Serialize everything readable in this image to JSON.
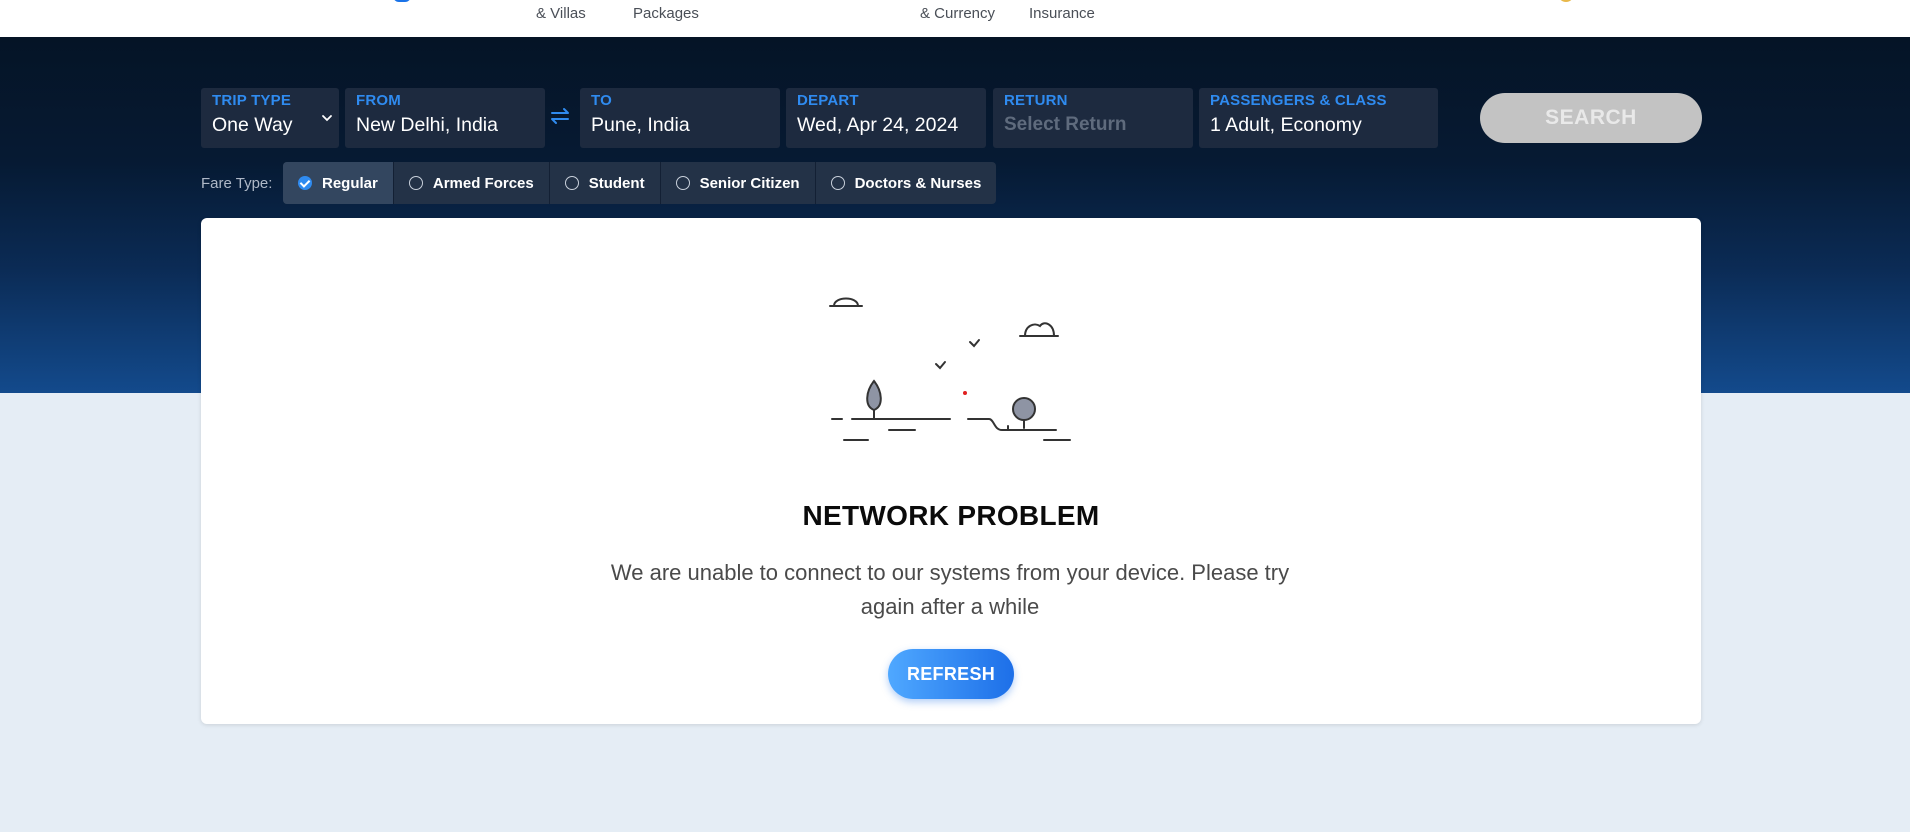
{
  "nav": {
    "fragments": [
      "& Villas",
      "Packages",
      "& Currency",
      "Insurance"
    ]
  },
  "search": {
    "trip_type": {
      "label": "TRIP TYPE",
      "value": "One Way"
    },
    "from": {
      "label": "FROM",
      "value": "New Delhi, India"
    },
    "to": {
      "label": "TO",
      "value": "Pune, India"
    },
    "depart": {
      "label": "DEPART",
      "value": "Wed, Apr 24, 2024"
    },
    "return": {
      "label": "RETURN",
      "placeholder": "Select Return"
    },
    "passengers": {
      "label": "PASSENGERS & CLASS",
      "value": "1 Adult, Economy"
    },
    "swap_icon": "swap-arrows-icon",
    "button_label": "SEARCH"
  },
  "fare_type": {
    "label": "Fare Type:",
    "options": [
      "Regular",
      "Armed Forces",
      "Student",
      "Senior Citizen",
      "Doctors & Nurses"
    ],
    "selected": "Regular"
  },
  "error": {
    "illustration": "network-problem-landscape-icon",
    "title": "NETWORK PROBLEM",
    "message": "We are unable to connect to our systems from your device. Please try again after a while",
    "button_label": "REFRESH"
  },
  "colors": {
    "accent": "#2f8bf0",
    "hero_dark": "#051426",
    "hero_light": "#134a8c",
    "page_bg": "#e5edf5",
    "field_bg": "#1d2a3f",
    "search_disabled": "#c3c3c3",
    "refresh_start": "#4fa8ff",
    "refresh_end": "#1d6fe8"
  }
}
